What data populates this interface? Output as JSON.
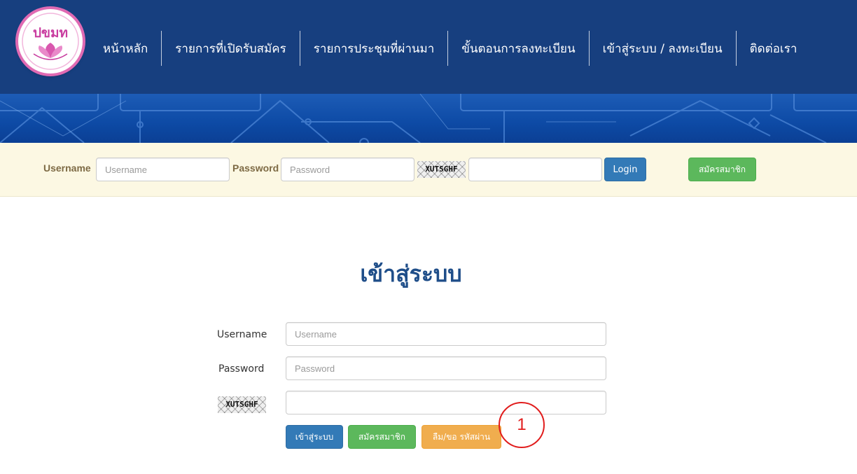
{
  "nav": {
    "items": [
      {
        "label": "หน้าหลัก"
      },
      {
        "label": "รายการที่เปิดรับสมัคร"
      },
      {
        "label": "รายการประชุมที่ผ่านมา"
      },
      {
        "label": "ขั้นตอนการลงทะเบียน"
      },
      {
        "label": "เข้าสู่ระบบ / ลงทะเบียน"
      },
      {
        "label": "ติดต่อเรา"
      }
    ]
  },
  "logo": {
    "icon": "lotus-logo-icon",
    "text": "ปขมท"
  },
  "top_login": {
    "username_label": "Username",
    "username_placeholder": "Username",
    "password_label": "Password",
    "password_placeholder": "Password",
    "captcha_text": "XUTSGHF",
    "captcha_value": "",
    "login_button": "Login",
    "register_button": "สมัครสมาชิก"
  },
  "main": {
    "title": "เข้าสู่ระบบ",
    "username_label": "Username",
    "username_placeholder": "Username",
    "password_label": "Password",
    "password_placeholder": "Password",
    "captcha_text": "XUTSGHF",
    "captcha_value": "",
    "login_button": "เข้าสู่ระบบ",
    "register_button": "สมัครสมาชิก",
    "forgot_button": "ลืม/ขอ รหัสผ่าน"
  },
  "annotation": {
    "number": "1",
    "color": "#e11d1d"
  },
  "colors": {
    "header": "#173f7f",
    "strip": "#fcf8e3",
    "primary": "#337ab7",
    "success": "#5cb85c",
    "warning": "#f0ad4e",
    "title": "#1f4e89"
  }
}
